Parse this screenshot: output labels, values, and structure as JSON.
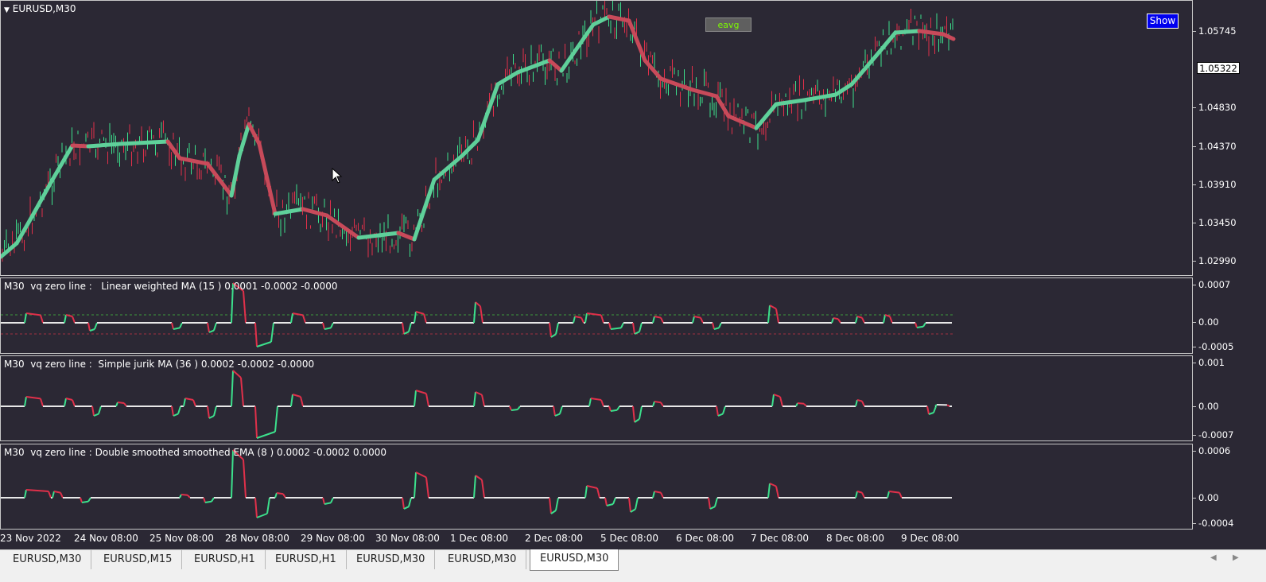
{
  "window": {
    "symbol_title": "EURUSD,M30"
  },
  "buttons": {
    "eavg": "eavg",
    "show": "Show"
  },
  "main_pane": {
    "price_ticks": [
      "1.05745",
      "1.04830",
      "1.04370",
      "1.03910",
      "1.03450",
      "1.02990"
    ],
    "current_price": "1.05322"
  },
  "subpanes": [
    {
      "label": "M30  vq zero line :   Linear weighted MA (15 ) 0.0001 -0.0002 -0.0000",
      "ticks": [
        "0.0007",
        "0.00",
        "-0.0005"
      ]
    },
    {
      "label": "M30  vq zero line :  Simple jurik MA (36 ) 0.0002 -0.0002 -0.0000",
      "ticks": [
        "0.001",
        "0.00",
        "-0.0007"
      ]
    },
    {
      "label": "M30  vq zero line : Double smoothed smoothed EMA (8 ) 0.0002 -0.0002 0.0000",
      "ticks": [
        "0.0006",
        "0.00",
        "-0.0004"
      ]
    }
  ],
  "time_axis": [
    "23 Nov 2022",
    "24 Nov 08:00",
    "25 Nov 08:00",
    "28 Nov 08:00",
    "29 Nov 08:00",
    "30 Nov 08:00",
    "1 Dec 08:00",
    "2 Dec 08:00",
    "5 Dec 08:00",
    "6 Dec 08:00",
    "7 Dec 08:00",
    "8 Dec 08:00",
    "9 Dec 08:00"
  ],
  "tabs": [
    {
      "label": "EURUSD,M30",
      "active": false
    },
    {
      "label": "EURUSD,M15",
      "active": false
    },
    {
      "label": "EURUSD,H1",
      "active": false
    },
    {
      "label": "EURUSD,H1",
      "active": false
    },
    {
      "label": "EURUSD,M30",
      "active": false
    },
    {
      "label": "EURUSD,M30",
      "active": false
    },
    {
      "label": "EURUSD,M30",
      "active": true
    }
  ],
  "icons": {
    "menu": "triangle-down-icon",
    "cursor": "mouse-cursor-icon",
    "left": "scroll-left-icon",
    "right": "scroll-right-icon"
  },
  "colors": {
    "background": "#2b2834",
    "bull": "#3ce08c",
    "bear": "#e0304a",
    "neutral": "#e8e8e8",
    "ma_up": "#5fd09a",
    "ma_down": "#c84a5a"
  }
}
